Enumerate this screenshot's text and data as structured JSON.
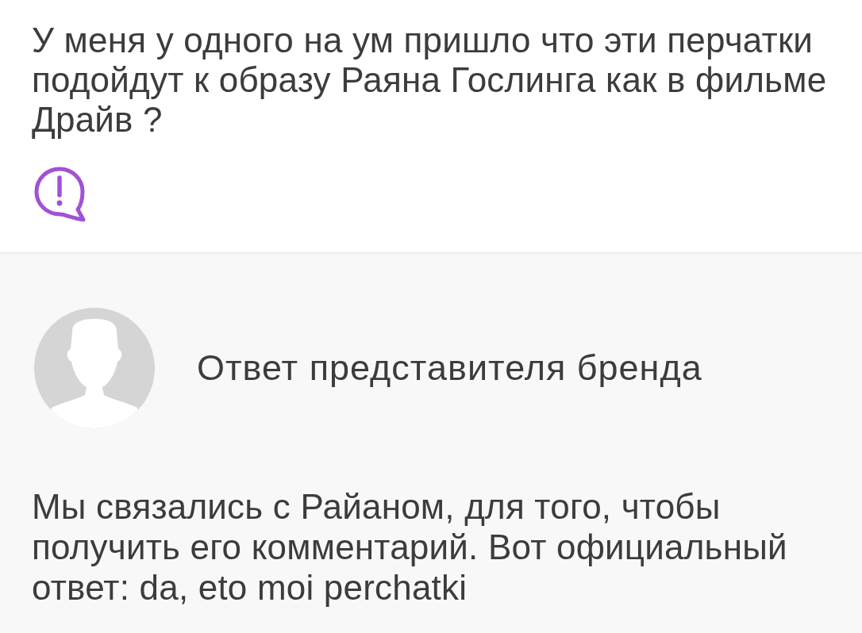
{
  "question": {
    "text": "У меня у одного на ум пришло что эти перчатки подойдут к образу Раяна Гослинга как в фильме Драйв ?"
  },
  "brand_reply": {
    "author": "Ответ представителя бренда",
    "text": "Мы связались с Райаном, для того, чтобы получить его комментарий. Вот официальный ответ: da, eto moi perchatki"
  }
}
